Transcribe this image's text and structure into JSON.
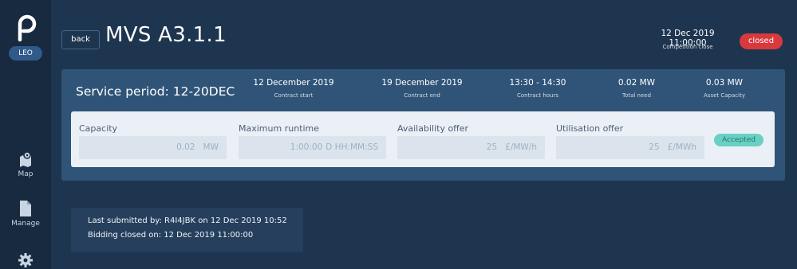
{
  "sidebar": {
    "user_badge": "LEO",
    "nav": [
      {
        "label": "Map",
        "icon": "map-icon"
      },
      {
        "label": "Manage",
        "icon": "document-icon"
      },
      {
        "label": "",
        "icon": "gear-icon"
      }
    ]
  },
  "header": {
    "back_label": "back",
    "title": "MVS A3.1.1",
    "close_time": "12 Dec 2019 11:00:00",
    "close_label": "Competition close",
    "status": "closed"
  },
  "service_period": {
    "title": "Service period: 12-20DEC",
    "stats": [
      {
        "value": "12 December 2019",
        "label": "Contract start"
      },
      {
        "value": "19 December 2019",
        "label": "Contract end"
      },
      {
        "value": "13:30 - 14:30",
        "label": "Contract hours"
      },
      {
        "value": "0.02 MW",
        "label": "Total need"
      },
      {
        "value": "0.03 MW",
        "label": "Asset Capacity"
      }
    ]
  },
  "offer": {
    "fields": [
      {
        "label": "Capacity",
        "value": "0.02",
        "unit": "MW"
      },
      {
        "label": "Maximum runtime",
        "value": "1:00:00",
        "unit": "D HH:MM:SS"
      },
      {
        "label": "Availability offer",
        "value": "25",
        "unit": "£/MW/h"
      },
      {
        "label": "Utilisation offer",
        "value": "25",
        "unit": "£/MWh"
      }
    ],
    "status": "Accepted"
  },
  "submission": {
    "last_submitted": "Last submitted by: R4I4JBK on 12 Dec 2019 10:52",
    "bidding_closed": "Bidding closed on: 12 Dec 2019 11:00:00"
  },
  "colors": {
    "background": "#1e3550",
    "sidebar": "#172a40",
    "panel": "#2f5478",
    "closed_badge": "#d8393d",
    "accepted_badge": "#6ad0c4"
  }
}
